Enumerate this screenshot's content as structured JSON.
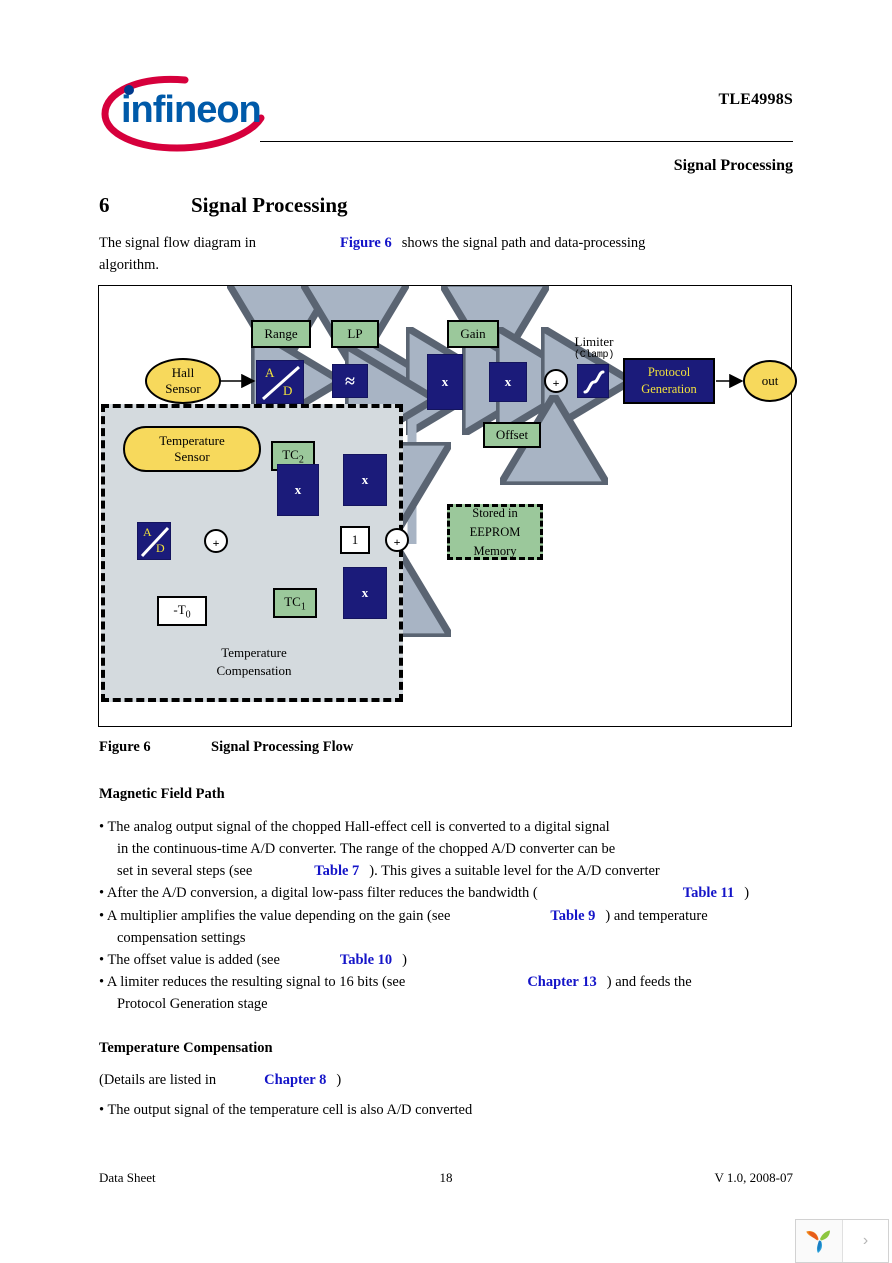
{
  "header": {
    "logo_text": "infineon",
    "part_number": "TLE4998S",
    "section_title": "Signal Processing"
  },
  "chapter": {
    "number": "6",
    "title": "Signal Processing"
  },
  "intro": {
    "text_before": "The signal flow diagram in",
    "link": "Figure 6",
    "text_after": "shows the signal path and data-processing",
    "line2": "algorithm."
  },
  "figure": {
    "caption_number": "Figure 6",
    "caption_title": "Signal Processing Flow",
    "blocks": {
      "range": "Range",
      "lp": "LP",
      "gain": "Gain",
      "offset": "Offset",
      "hall_sensor_line1": "Hall",
      "hall_sensor_line2": "Sensor",
      "temp_sensor_line1": "Temperature",
      "temp_sensor_line2": "Sensor",
      "ad_a": "A",
      "ad_d": "D",
      "lowpass_symbol": "≈",
      "multiplier": "x",
      "sum": "+",
      "limiter_label": "Limiter",
      "limiter_sublabel": "(Clamp)",
      "protocol_line1": "Protocol",
      "protocol_line2": "Generation",
      "out": "out",
      "tc2_label": "TC",
      "tc2_sub": "2",
      "tc1_label": "TC",
      "tc1_sub": "1",
      "one": "1",
      "neg_t0": "-T",
      "neg_t0_sub": "0",
      "tc_region_line1": "Temperature",
      "tc_region_line2": "Compensation",
      "eeprom_line1": "Stored in",
      "eeprom_line2": "EEPROM",
      "eeprom_line3": "Memory"
    },
    "colors": {
      "navy": "#1b1b7a",
      "green": "#9bc89b",
      "yellow": "#f7d95c",
      "gray_region": "#d4dade",
      "arrow": "#a8b4c4",
      "proto_text": "#f2e23c"
    }
  },
  "magnetic_field_path": {
    "heading": "Magnetic Field Path",
    "bullets": [
      {
        "parts": [
          {
            "t": "• The analog output signal of the chopped Hall-effect cell is converted to a digital signal"
          }
        ]
      },
      {
        "parts": [
          {
            "t": "in the continuous-time A/D converter. The range of the chopped A/D converter can be"
          }
        ]
      },
      {
        "parts": [
          {
            "t": "set in several steps (see"
          },
          {
            "link": "Table 7"
          },
          {
            "t": "). This gives a suitable level for the A/D converter"
          }
        ]
      },
      {
        "parts": [
          {
            "t": "• After the A/D conversion, a digital low-pass filter reduces the bandwidth ("
          },
          {
            "link": "Table 11"
          },
          {
            "t": ")"
          }
        ]
      },
      {
        "parts": [
          {
            "t": "• A multiplier amplifies the value depending on the gain (see"
          },
          {
            "link": "Table 9"
          },
          {
            "t": ") and temperature"
          }
        ]
      },
      {
        "parts": [
          {
            "t": "compensation settings"
          }
        ]
      },
      {
        "parts": [
          {
            "t": "• The offset value is added (see"
          },
          {
            "link": "Table 10"
          },
          {
            "t": ")"
          }
        ]
      },
      {
        "parts": [
          {
            "t": "• A limiter reduces the resulting signal to 16 bits (see"
          },
          {
            "link": "Chapter 13"
          },
          {
            "t": ") and feeds the"
          }
        ]
      },
      {
        "parts": [
          {
            "t": "Protocol Generation stage"
          }
        ]
      }
    ],
    "line_1": "• The analog output signal of the chopped Hall-effect cell is converted to a digital signal",
    "line_2": "in the continuous-time A/D converter. The range of the chopped A/D converter can be",
    "line_3a": "set in several steps (see",
    "line_3_link": "Table 7",
    "line_3b": "). This gives a suitable level for the A/D converter",
    "line_4a": "• After the A/D conversion, a digital low-pass filter reduces the bandwidth (",
    "line_4_link": "Table 11",
    "line_4b": ")",
    "line_5a": "• A multiplier amplifies the value depending on the gain (see",
    "line_5_link": "Table 9",
    "line_5b": ") and temperature",
    "line_6": "compensation settings",
    "line_7a": "• The offset value is added (see",
    "line_7_link": "Table 10",
    "line_7b": ")",
    "line_8a": "• A limiter reduces the resulting signal to 16 bits (see",
    "line_8_link": "Chapter 13",
    "line_8b": ") and feeds the",
    "line_9": "Protocol Generation stage"
  },
  "temperature_compensation": {
    "heading": "Temperature Compensation",
    "details_prefix": "(Details are listed in",
    "details_link": "Chapter 8",
    "details_suffix": ")",
    "bullet_1": "• The output signal of the temperature cell is also A/D converted"
  },
  "footer": {
    "left": "Data Sheet",
    "page": "18",
    "right": "V 1.0, 2008-07"
  },
  "widget": {
    "logo_icon": "youdao-leaf-icon",
    "expand_icon": "chevron-right-icon",
    "expand_glyph": "›"
  }
}
